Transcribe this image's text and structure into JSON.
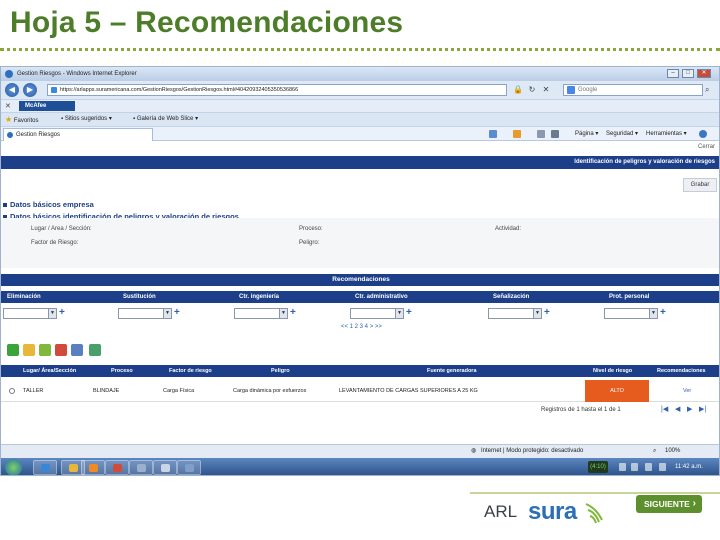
{
  "slide": {
    "title": "Hoja 5 – Recomendaciones",
    "next_label": "SIGUIENTE",
    "logo_arl": "ARL",
    "logo_sura": "sura"
  },
  "browser": {
    "window_title": "Gestion Riesgos - Windows Internet Explorer",
    "url": "https://arlapps.suramericana.com/GestionRiesgos/GestionRiesgos.html#40420932405350536866",
    "search_engine": "Google",
    "toolbar_vendor": "McAfee",
    "favorites": [
      {
        "label": "Favoritos"
      },
      {
        "label": "Sitios sugeridos"
      },
      {
        "label": "Galería de Web Slice"
      }
    ],
    "tab_label": "Gestion Riesgos",
    "commands": [
      {
        "label": "Página"
      },
      {
        "label": "Seguridad"
      },
      {
        "label": "Herramientas"
      }
    ],
    "status_zone": "Internet | Modo protegido: desactivado",
    "zoom": "100%"
  },
  "app": {
    "close_label": "Cerrar",
    "header": "Identificación de peligros y valoración de riesgos",
    "save_label": "Grabar",
    "sections": [
      {
        "label": "Datos básicos empresa"
      },
      {
        "label": "Datos básicos identificación de peligros y valoración de riesgos"
      }
    ],
    "info_labels": {
      "location": "Lugar / Area / Sección:",
      "process": "Proceso:",
      "activity": "Actividad:",
      "risk_factor": "Factor de Riesgo:",
      "hazard": "Peligro:"
    },
    "recommendations": {
      "title": "Recomendaciones",
      "columns": [
        {
          "label": "Eliminación"
        },
        {
          "label": "Sustitución"
        },
        {
          "label": "Ctr. ingeniería"
        },
        {
          "label": "Ctr. administrativo"
        },
        {
          "label": "Señalización"
        },
        {
          "label": "Prot. personal"
        }
      ],
      "pager": "<< 1 2 3 4 > >>"
    },
    "grid": {
      "headers": [
        "Lugar/ Área/Sección",
        "Proceso",
        "Factor de riesgo",
        "Peligro",
        "Fuente generadora",
        "Nivel de riesgo",
        "Recomendaciones"
      ],
      "rows": [
        {
          "location": "TALLER",
          "process": "BLINDAJE",
          "risk_factor": "Carga Física",
          "hazard": "Carga dinámica por esfuerzos",
          "source": "LEVANTAMIENTO DE CARGAS SUPERIORES A 25 KG",
          "level": "ALTO",
          "action": "Ver"
        }
      ],
      "records_text": "Registros de 1 hasta el 1 de 1"
    }
  },
  "taskbar": {
    "tray_badge": "(4:10)",
    "clock": "11:42 a.m."
  },
  "colors": {
    "title_green": "#4e7d2a",
    "app_blue": "#1d3f8a",
    "risk_high": "#e65b1e",
    "sura_blue": "#2b6fb6",
    "next_green": "#5e8f2f"
  }
}
